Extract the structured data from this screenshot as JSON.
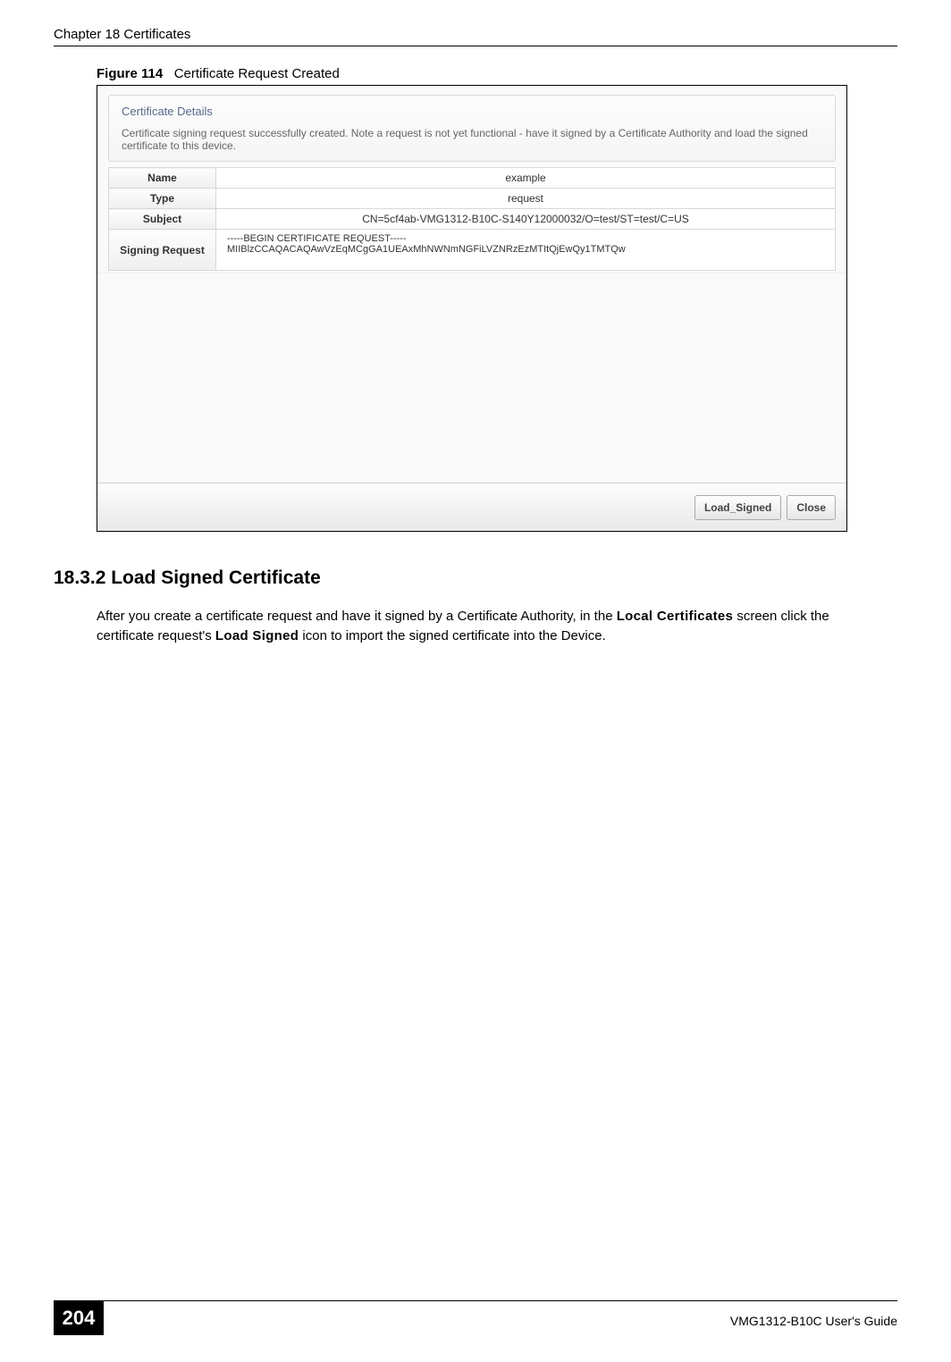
{
  "header": {
    "chapter": "Chapter 18 Certificates"
  },
  "figure": {
    "label": "Figure 114",
    "caption": "Certificate Request Created"
  },
  "panel": {
    "details_title": "Certificate Details",
    "details_text": "Certificate signing request successfully created. Note a request is not yet functional - have it signed by a Certificate Authority and load the signed certificate to this device.",
    "rows": {
      "name_label": "Name",
      "name_value": "example",
      "type_label": "Type",
      "type_value": "request",
      "subject_label": "Subject",
      "subject_value": "CN=5cf4ab-VMG1312-B10C-S140Y12000032/O=test/ST=test/C=US",
      "signing_label": "Signing Request",
      "signing_value": "-----BEGIN CERTIFICATE REQUEST-----\nMIIBlzCCAQACAQAwVzEqMCgGA1UEAxMhNWNmNGFiLVZNRzEzMTItQjEwQy1TMTQw"
    },
    "buttons": {
      "load_signed": "Load_Signed",
      "close": "Close"
    }
  },
  "section": {
    "number_title": "18.3.2  Load Signed Certificate",
    "para_pre": "After you create a certificate request and have it signed by a Certificate Authority, in the ",
    "local_cert": "Local Certificates",
    "para_mid1": " screen click the certificate request's ",
    "load_signed": "Load Signed",
    "para_post": " icon to import the signed certificate into the Device."
  },
  "footer": {
    "page": "204",
    "guide": "VMG1312-B10C User's Guide"
  }
}
